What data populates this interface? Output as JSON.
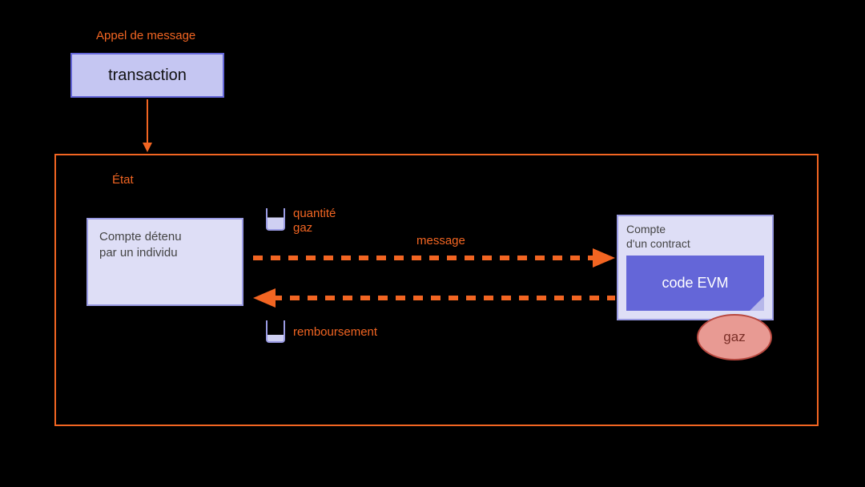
{
  "titles": {
    "appel": "Appel de message",
    "etat": "État",
    "message": "message"
  },
  "transaction": {
    "label": "transaction"
  },
  "account_individual": {
    "text": "Compte détenu\npar un individu"
  },
  "account_contract": {
    "header": "Compte\nd'un contract",
    "evm": "code EVM"
  },
  "gas_bubble": {
    "label": "gaz"
  },
  "tank_top": {
    "line1": "quantité",
    "line2": "gaz"
  },
  "tank_bottom": {
    "label": "remboursement"
  },
  "colors": {
    "accent": "#f26522",
    "purpleFill": "#dedef6",
    "purpleBorder": "#9a9be3",
    "purpleStrong": "#6466d8"
  }
}
